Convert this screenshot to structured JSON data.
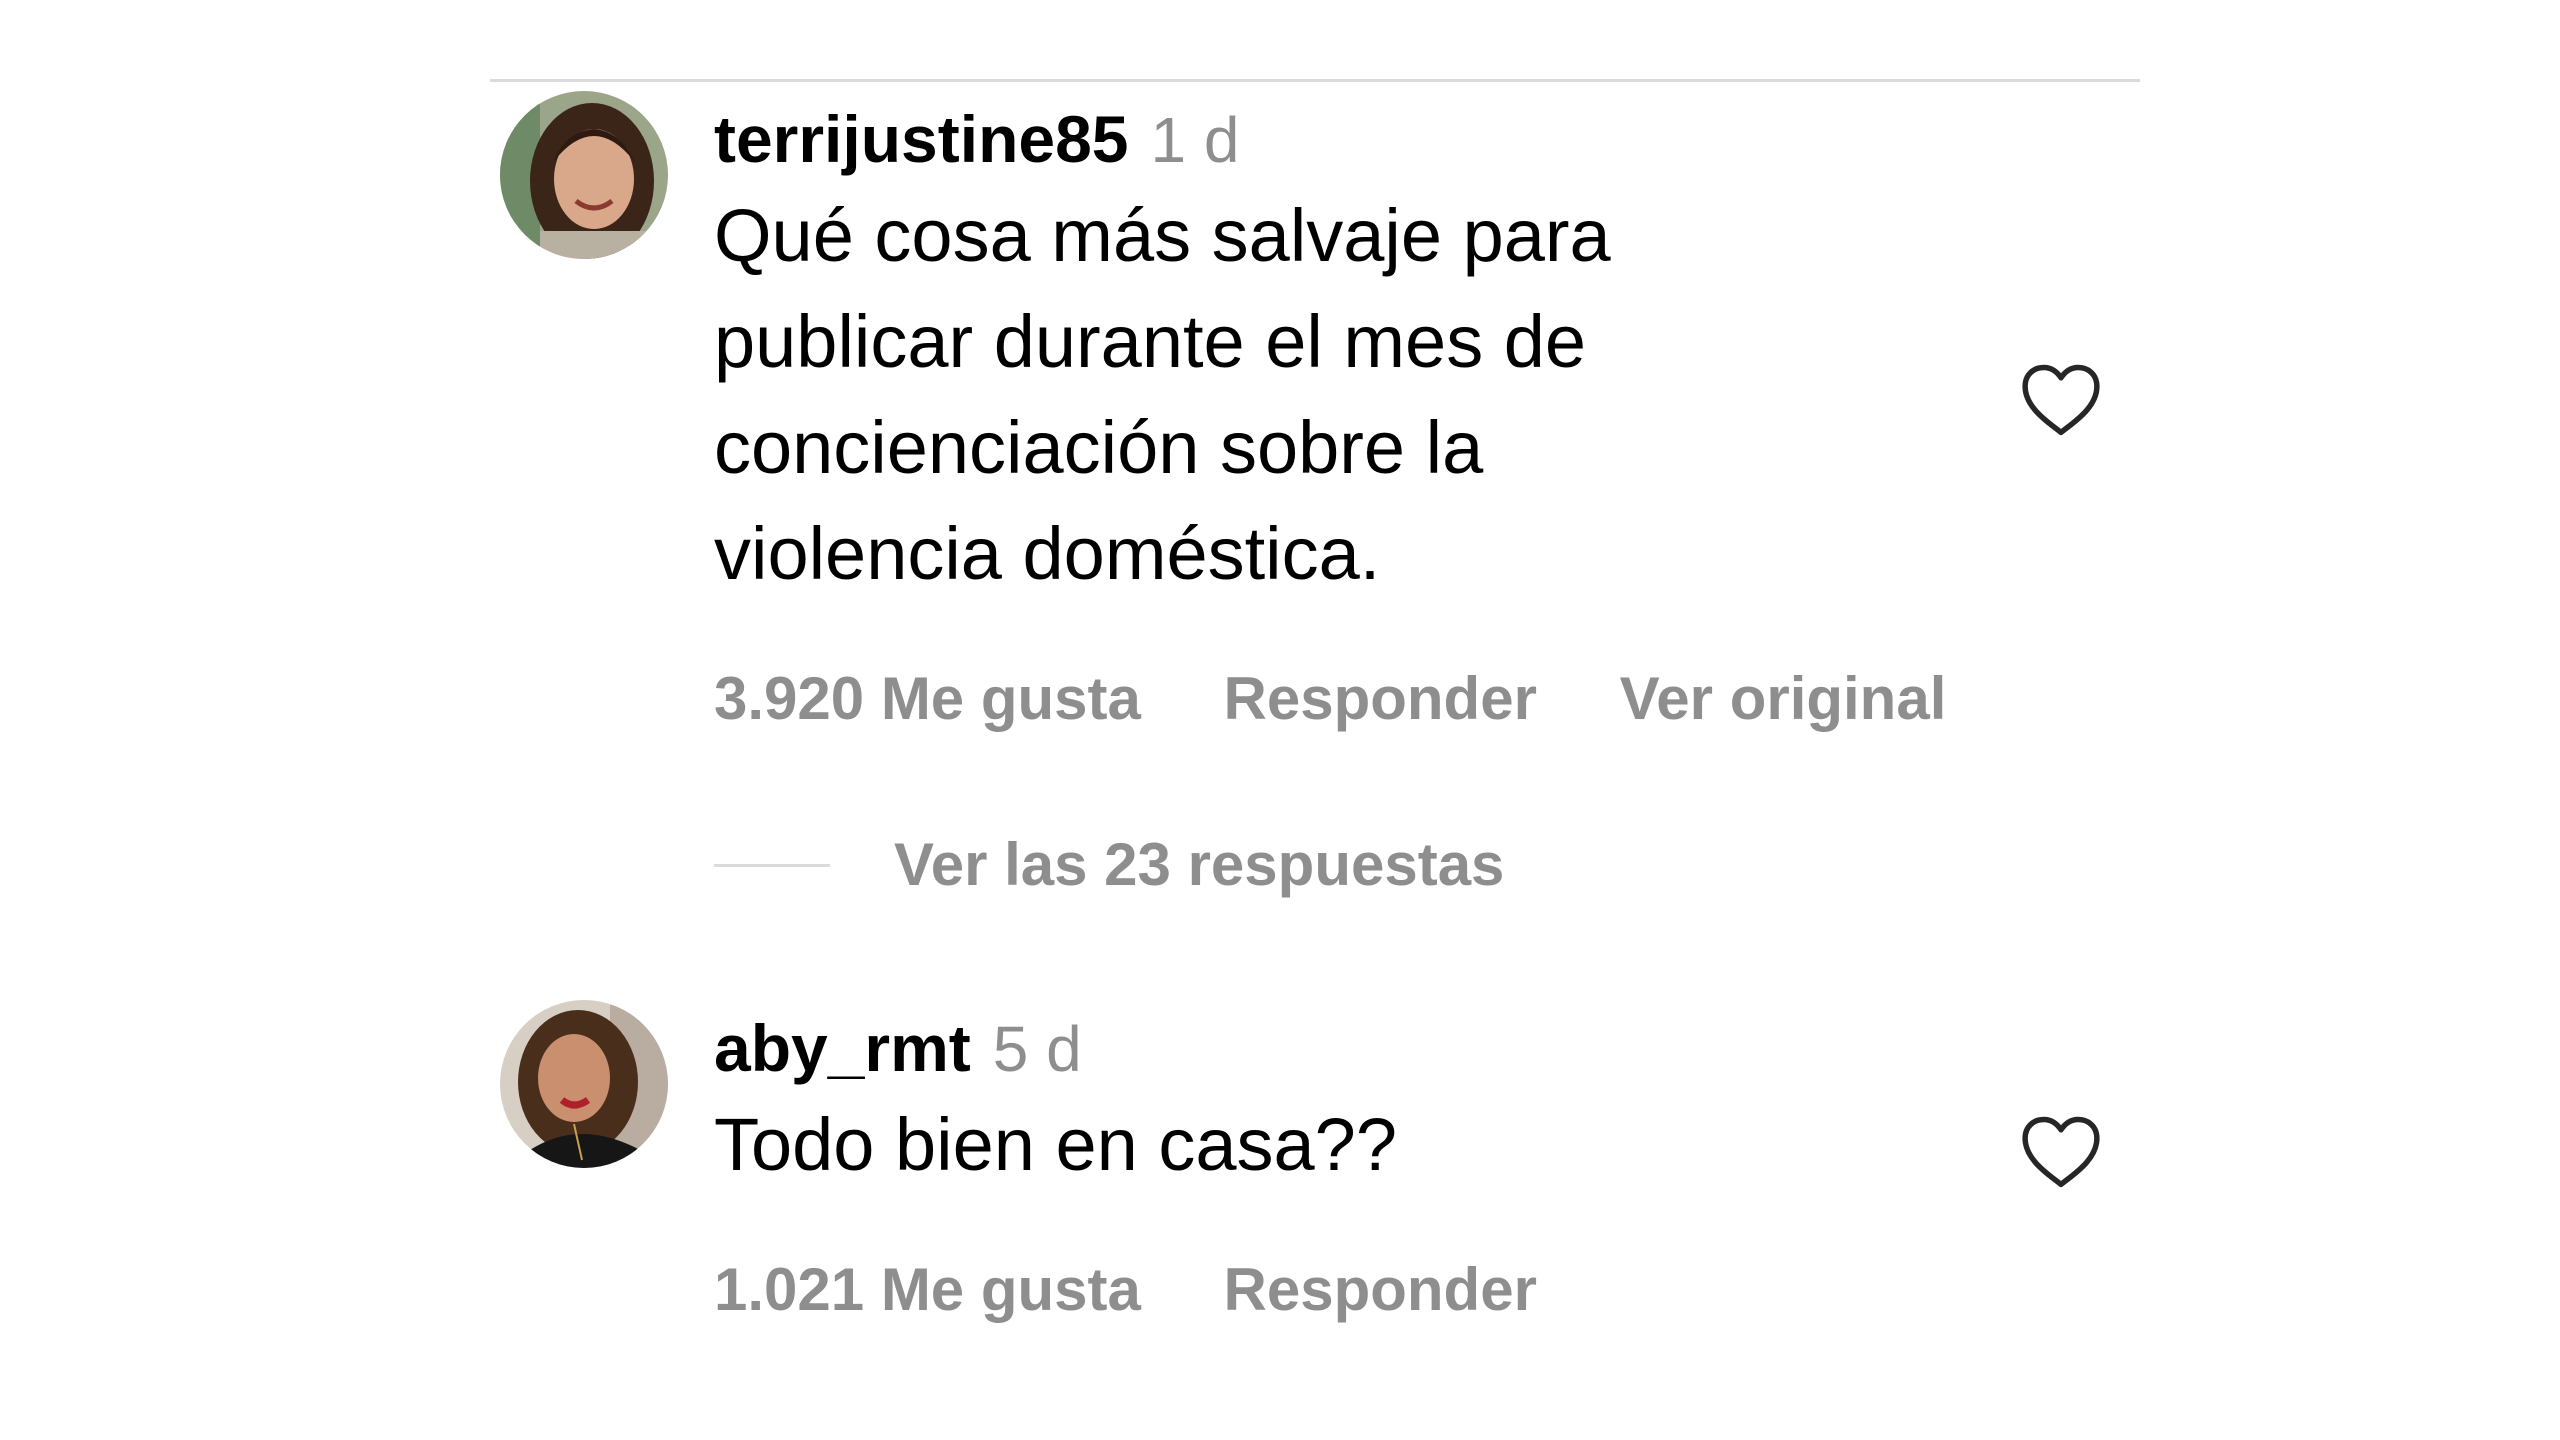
{
  "comments": [
    {
      "username": "terrijustine85",
      "time": "1 d",
      "text": "Qué cosa más salvaje para\npublicar durante el mes de\nconcienciación sobre la\nviolencia doméstica.",
      "likes": "3.920 Me gusta",
      "reply": "Responder",
      "see_original": "Ver original",
      "like_icon": "heart-outline-icon",
      "view_replies": "Ver las 23 respuestas"
    },
    {
      "username": "aby_rmt",
      "time": "5 d",
      "text": "Todo bien en casa??",
      "likes": "1.021 Me gusta",
      "reply": "Responder",
      "like_icon": "heart-outline-icon"
    }
  ],
  "colors": {
    "text": "#000000",
    "secondary": "#8e8e8e",
    "divider": "#dbdbdb",
    "background": "#ffffff"
  }
}
